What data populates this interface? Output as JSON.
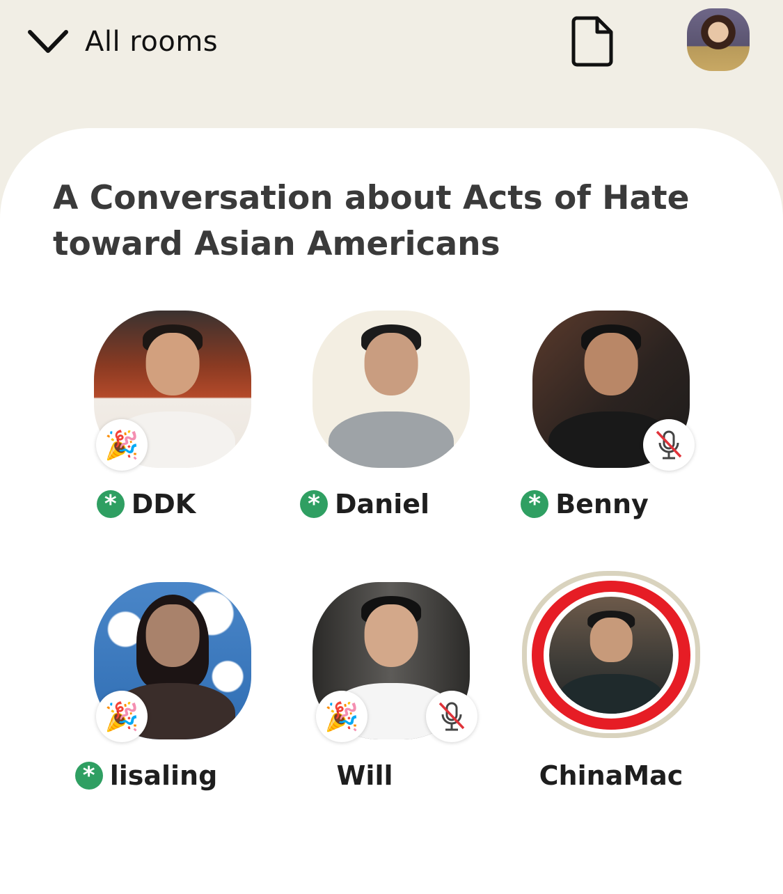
{
  "header": {
    "back_label": "All rooms",
    "icons": [
      "chevron-down-icon",
      "document-icon",
      "profile-avatar"
    ]
  },
  "room": {
    "title": "A Conversation about Acts of Hate toward Asian Americans"
  },
  "speakers": [
    {
      "name": "DDK",
      "moderator": true,
      "badge": "new-user-party-icon",
      "muted": false
    },
    {
      "name": "Daniel",
      "moderator": true,
      "badge": null,
      "muted": false
    },
    {
      "name": "Benny",
      "moderator": true,
      "badge": null,
      "muted": true
    },
    {
      "name": "lisaling",
      "moderator": true,
      "badge": "new-user-party-icon",
      "muted": false
    },
    {
      "name": "Will",
      "moderator": false,
      "badge": "new-user-party-icon",
      "muted": true
    },
    {
      "name": "ChinaMac",
      "moderator": false,
      "badge": null,
      "muted": false,
      "speaking": true
    }
  ],
  "colors": {
    "background": "#f1eee5",
    "sheet": "#ffffff",
    "moderator_green": "#2f9f62",
    "speaking_ring": "#e61d25",
    "muted_slash": "#e0333a"
  }
}
